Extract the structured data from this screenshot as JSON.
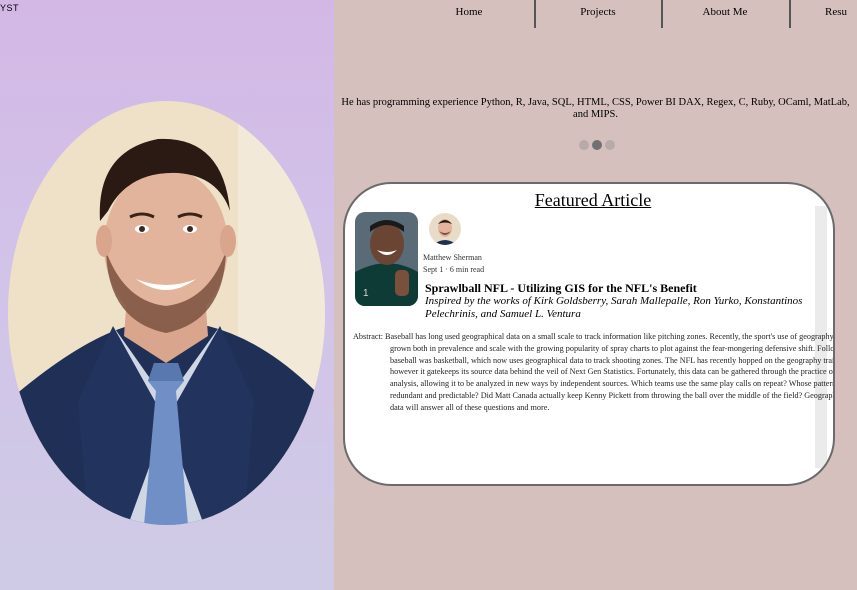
{
  "brand": {
    "fragment": "YST"
  },
  "nav": {
    "items": [
      {
        "label": "Home"
      },
      {
        "label": "Projects"
      },
      {
        "label": "About Me"
      },
      {
        "label": "Resu"
      }
    ]
  },
  "bio": {
    "text": "He has programming experience Python, R, Java, SQL, HTML, CSS, Power BI DAX, Regex, C, Ruby, OCaml, MatLab, and MIPS."
  },
  "carousel": {
    "slide_count": 3,
    "active_index": 1
  },
  "featured": {
    "heading": "Featured Article",
    "author": "Matthew Sherman",
    "meta": "Sept 1 · 6 min read",
    "title": "Sprawlball NFL - Utilizing GIS for the NFL's Benefit",
    "subtitle": "Inspired by the works of Kirk Goldsberry, Sarah Mallepalle, Ron Yurko, Konstantinos Pelechrinis, and Samuel L. Ventura",
    "abstract": "Abstract: Baseball has long used geographical data on a small scale to track information like pitching zones. Recently, the sport's use of geography has grown both in prevalence and scale with the growing popularity of spray charts to plot against the fear-mongering defensive shift. Following baseball was basketball, which now uses geographical data to track shooting zones. The NFL has recently hopped on the geography train, however it gatekeeps its source data behind the veil of Next Gen Statistics. Fortunately, this data can be gathered through the practice of image analysis, allowing it to be analyzed in new ways by independent sources. Which teams use the same play calls on repeat? Whose patterns are redundant and predictable? Did Matt Canada actually keep Kenny Pickett from throwing the ball over the middle of the field? Geographical data will answer all of these questions and more."
  },
  "colors": {
    "left_bg": "#d3b8e6",
    "right_bg": "#d6c0bd",
    "card_border": "#6b6b6b",
    "suit": "#1f2f55",
    "tie": "#6f8fc6"
  }
}
